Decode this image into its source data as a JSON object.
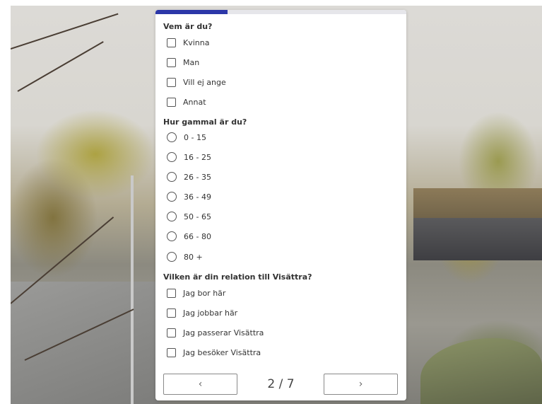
{
  "progress": {
    "value": 0.286
  },
  "questions": [
    {
      "title": "Vem är du?",
      "type": "checkbox",
      "options": [
        "Kvinna",
        "Man",
        "Vill ej ange",
        "Annat"
      ]
    },
    {
      "title": "Hur gammal är du?",
      "type": "radio",
      "options": [
        "0 - 15",
        "16 - 25",
        "26 - 35",
        "36 - 49",
        "50 - 65",
        "66 - 80",
        "80 +"
      ]
    },
    {
      "title": "Vilken är din relation till Visättra?",
      "type": "checkbox",
      "options": [
        "Jag bor här",
        "Jag jobbar här",
        "Jag passerar Visättra",
        "Jag besöker Visättra"
      ]
    }
  ],
  "nav": {
    "prev_label": "‹",
    "next_label": "›",
    "page_indicator": "2 / 7"
  },
  "colors": {
    "accent": "#2c37a8"
  }
}
